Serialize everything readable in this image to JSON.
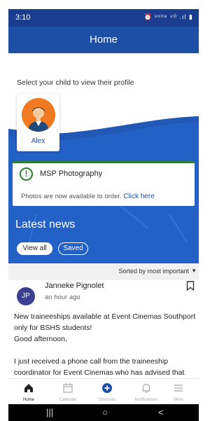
{
  "status_bar": {
    "time": "3:10",
    "icons_text": "⏰ ᵛᵒˡᵗᵉ ⁴ᴳ .ıl ▮"
  },
  "header": {
    "title": "Home"
  },
  "children": {
    "prompt": "Select your child to view their profile",
    "items": [
      {
        "name": "Alex"
      }
    ]
  },
  "notice": {
    "title": "MSP Photography",
    "text": "Photos are now available to order.",
    "link": "Click here"
  },
  "news": {
    "title": "Latest news",
    "filters": [
      {
        "label": "View all",
        "selected": true
      },
      {
        "label": "Saved",
        "selected": false
      }
    ],
    "sort_label": "Sorted by most important"
  },
  "post": {
    "avatar_initials": "JP",
    "author": "Janneke Pignolet",
    "time": "an hour ago",
    "body": [
      "New traineeships available at Event Cinemas Southport only for BSHS students!",
      "Good afternoon,",
      "",
      "I just received a phone call from the traineeship coordinator for Event Cinemas who has advised that"
    ]
  },
  "bottom_nav": {
    "items": [
      {
        "label": "Home",
        "icon": "home-icon",
        "active": true
      },
      {
        "label": "Calendar",
        "icon": "calendar-icon",
        "active": false
      },
      {
        "label": "Shortcuts",
        "icon": "plus-circle-icon",
        "active": false
      },
      {
        "label": "Notifications",
        "icon": "bell-icon",
        "active": false
      },
      {
        "label": "More",
        "icon": "menu-icon",
        "active": false
      }
    ]
  },
  "system_nav": {
    "recents": "|||",
    "home": "○",
    "back": "<"
  },
  "colors": {
    "primary": "#1d4fa6",
    "accent_green": "#2e7d32",
    "avatar_orange": "#f07a21"
  }
}
